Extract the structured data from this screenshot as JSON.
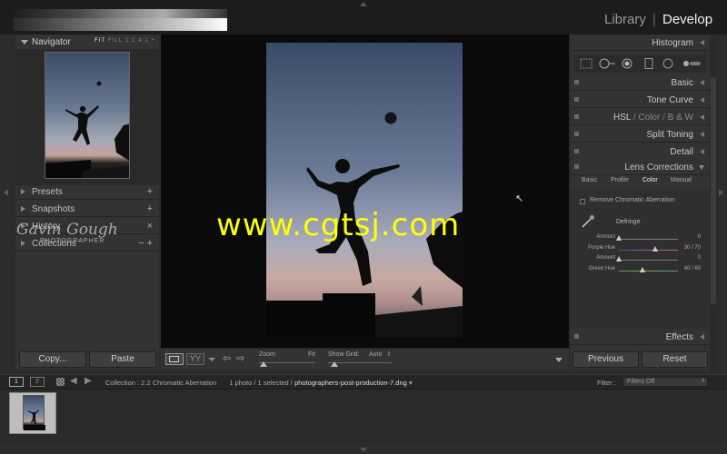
{
  "modules": {
    "library": "Library",
    "separator": "|",
    "develop": "Develop"
  },
  "navigator": {
    "title": "Navigator",
    "zoom_options": [
      "FIT",
      "FILL",
      "1:1",
      "4:1"
    ],
    "zoom_dropdown": "÷"
  },
  "left_panels": [
    {
      "label": "Presets",
      "action": "+"
    },
    {
      "label": "Snapshots",
      "action": "+"
    },
    {
      "label": "History",
      "action": "×"
    },
    {
      "label": "Collections",
      "action": "− +"
    }
  ],
  "identity": {
    "signature": "Gavin Gough",
    "subtitle": "PHOTOGRAPHER"
  },
  "left_buttons": {
    "copy": "Copy...",
    "paste": "Paste"
  },
  "right_panels": {
    "histogram": "Histogram",
    "basic": "Basic",
    "tone_curve": "Tone Curve",
    "hsl": "HSL",
    "hsl_sep": "/",
    "color": "Color",
    "bw": "B & W",
    "split_toning": "Split Toning",
    "detail": "Detail",
    "lens_corrections": "Lens Corrections",
    "effects": "Effects"
  },
  "lens_tabs": [
    {
      "label": "Basic",
      "selected": false
    },
    {
      "label": "Profile",
      "selected": false
    },
    {
      "label": "Color",
      "selected": true
    },
    {
      "label": "Manual",
      "selected": false
    }
  ],
  "lens_color": {
    "remove_ca": "Remove Chromatic Aberration",
    "defringe": "Defringe",
    "sliders": [
      {
        "label": "Amount",
        "value": "0",
        "pos": 0.0,
        "track": "#7a7a7a"
      },
      {
        "label": "Purple Hue",
        "value": "30 / 70",
        "pos": 0.62,
        "track": "linear-gradient(90deg,#5a4a9a,#9a5aa8,#c05a7a)"
      },
      {
        "label": "Amount",
        "value": "0",
        "pos": 0.0,
        "track": "#7a7a7a"
      },
      {
        "label": "Green Hue",
        "value": "40 / 60",
        "pos": 0.4,
        "track": "linear-gradient(90deg,#5a9a4a,#7aa85a,#4a9aa0)"
      }
    ]
  },
  "right_buttons": {
    "previous": "Previous",
    "reset": "Reset"
  },
  "toolbar": {
    "zoom_label": "Zoom",
    "zoom_value": "Fit",
    "grid_label": "Show Grid:",
    "grid_value": "Auto",
    "grid_dropdown": "⇕",
    "back": "⇦",
    "forward": "⇨",
    "compare": "YY"
  },
  "filmstrip_bar": {
    "monitor1": "1",
    "monitor2": "2",
    "back": "◀",
    "forward": "▶",
    "collection": "Collection : 2.2 Chromatic Aberration",
    "photos": "1 photo / 1 selected /",
    "file": "photographers-post-production-7.dng",
    "file_dropdown": "▾",
    "filter_label": "Filter :",
    "filter_value": "Filters Off",
    "filter_dropdown": "⇕"
  },
  "watermark": "www.cgtsj.com",
  "cursor": "↖"
}
